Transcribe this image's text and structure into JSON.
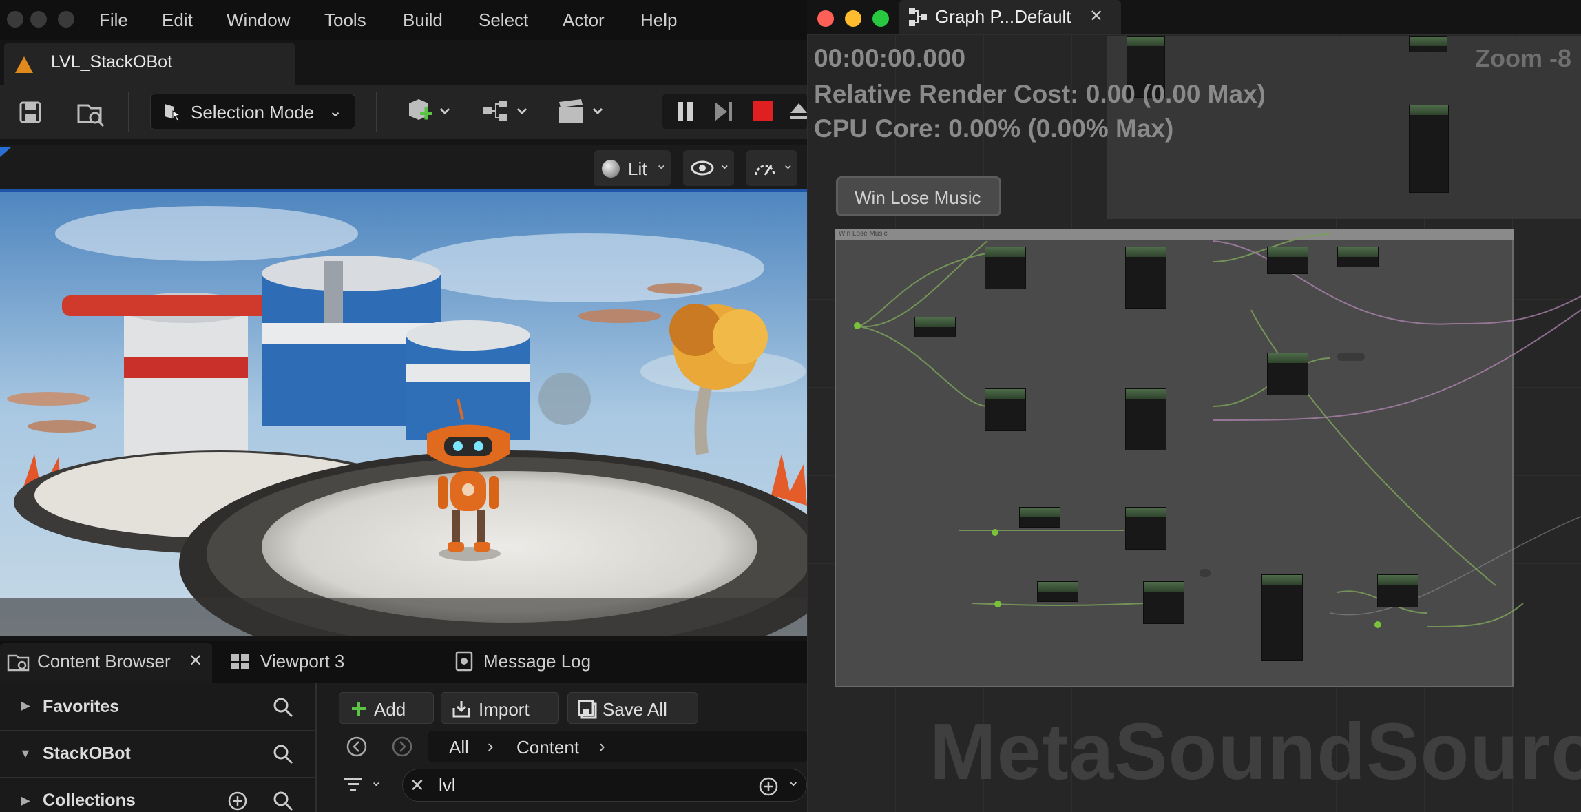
{
  "menubar": {
    "items": [
      "File",
      "Edit",
      "Window",
      "Tools",
      "Build",
      "Select",
      "Actor",
      "Help"
    ]
  },
  "level_tab": {
    "title": "LVL_StackOBot"
  },
  "toolbar": {
    "selection_mode": "Selection Mode"
  },
  "viewport_bar": {
    "view_mode": "Lit"
  },
  "bottom_tabs": {
    "content_browser": "Content Browser",
    "viewport3": "Viewport 3",
    "message_log": "Message Log"
  },
  "content_browser": {
    "sections": {
      "favorites": "Favorites",
      "project": "StackOBot",
      "collections": "Collections"
    },
    "buttons": {
      "add": "Add",
      "import": "Import",
      "save_all": "Save All"
    },
    "breadcrumb": [
      "All",
      "Content"
    ],
    "search_value": "lvl"
  },
  "graph_window": {
    "tab_title": "Graph P...Default",
    "time": "00:00:00.000",
    "render_cost": "Relative Render Cost: 0.00 (0.00 Max)",
    "cpu_core": "CPU Core: 0.00% (0.00% Max)",
    "zoom": "Zoom -8",
    "comment_bubble": "Win Lose Music",
    "comment_header": "Win Lose Music",
    "watermark": "MetaSoundSource"
  },
  "colors": {
    "accent_blue": "#1e55a8",
    "stop_red": "#e02020",
    "add_green": "#5cc445",
    "level_icon": "#e08a1e",
    "node_header": "#4e6b4a",
    "wire": "#7a9c5a"
  }
}
